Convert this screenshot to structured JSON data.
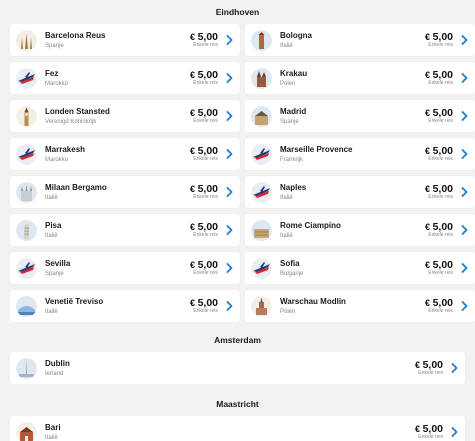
{
  "colors": {
    "accent": "#1a7fd0",
    "background": "#f2f2f2",
    "card": "#ffffff"
  },
  "sections": [
    {
      "title": "Eindhoven",
      "destinations": [
        {
          "city": "Barcelona Reus",
          "country": "Spanje",
          "currency": "€",
          "price": "5,00",
          "fare_type": "Enkele reis",
          "icon": "sagrada-familia-icon"
        },
        {
          "city": "Bologna",
          "country": "Italië",
          "currency": "€",
          "price": "5,00",
          "fare_type": "Enkele reis",
          "icon": "tower-icon"
        },
        {
          "city": "Fez",
          "country": "Marokko",
          "currency": "€",
          "price": "5,00",
          "fare_type": "Enkele reis",
          "icon": "airplane-flag-icon"
        },
        {
          "city": "Krakau",
          "country": "Polen",
          "currency": "€",
          "price": "5,00",
          "fare_type": "Enkele reis",
          "icon": "church-icon"
        },
        {
          "city": "Londen Stansted",
          "country": "Verenigd Koninkrijk",
          "currency": "€",
          "price": "5,00",
          "fare_type": "Enkele reis",
          "icon": "big-ben-icon"
        },
        {
          "city": "Madrid",
          "country": "Spanje",
          "currency": "€",
          "price": "5,00",
          "fare_type": "Enkele reis",
          "icon": "palace-icon"
        },
        {
          "city": "Marrakesh",
          "country": "Marokko",
          "currency": "€",
          "price": "5,00",
          "fare_type": "Enkele reis",
          "icon": "airplane-flag-icon"
        },
        {
          "city": "Marseille Provence",
          "country": "Frankrijk",
          "currency": "€",
          "price": "5,00",
          "fare_type": "Enkele reis",
          "icon": "airplane-flag-icon"
        },
        {
          "city": "Milaan Bergamo",
          "country": "Italië",
          "currency": "€",
          "price": "5,00",
          "fare_type": "Enkele reis",
          "icon": "cathedral-icon"
        },
        {
          "city": "Naples",
          "country": "Italië",
          "currency": "€",
          "price": "5,00",
          "fare_type": "Enkele reis",
          "icon": "airplane-flag-icon"
        },
        {
          "city": "Pisa",
          "country": "Italië",
          "currency": "€",
          "price": "5,00",
          "fare_type": "Enkele reis",
          "icon": "leaning-tower-icon"
        },
        {
          "city": "Rome Ciampino",
          "country": "Italië",
          "currency": "€",
          "price": "5,00",
          "fare_type": "Enkele reis",
          "icon": "colosseum-icon"
        },
        {
          "city": "Sevilla",
          "country": "Spanje",
          "currency": "€",
          "price": "5,00",
          "fare_type": "Enkele reis",
          "icon": "airplane-flag-icon"
        },
        {
          "city": "Sofia",
          "country": "Bulgarije",
          "currency": "€",
          "price": "5,00",
          "fare_type": "Enkele reis",
          "icon": "airplane-flag-icon"
        },
        {
          "city": "Venetië Treviso",
          "country": "Italië",
          "currency": "€",
          "price": "5,00",
          "fare_type": "Enkele reis",
          "icon": "bridge-icon"
        },
        {
          "city": "Warschau Modlin",
          "country": "Polen",
          "currency": "€",
          "price": "5,00",
          "fare_type": "Enkele reis",
          "icon": "palace-of-culture-icon"
        }
      ]
    },
    {
      "title": "Amsterdam",
      "destinations": [
        {
          "city": "Dublin",
          "country": "Ierland",
          "currency": "€",
          "price": "5,00",
          "fare_type": "Enkele reis",
          "icon": "spire-icon"
        }
      ]
    },
    {
      "title": "Maastricht",
      "destinations": [
        {
          "city": "Bari",
          "country": "Italië",
          "currency": "€",
          "price": "5,00",
          "fare_type": "Enkele reis",
          "icon": "basilica-icon"
        }
      ]
    }
  ]
}
